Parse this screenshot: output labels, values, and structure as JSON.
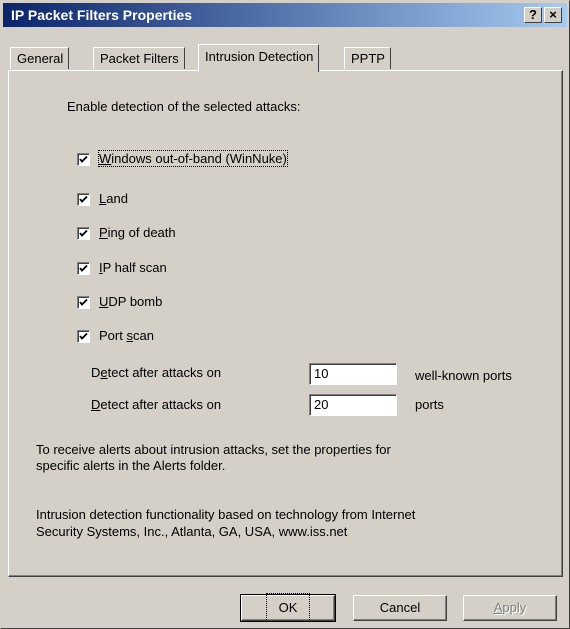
{
  "window": {
    "title": "IP Packet Filters Properties",
    "help_label": "?",
    "close_label": "×"
  },
  "tabs": [
    {
      "label": "General",
      "active": false
    },
    {
      "label": "Packet Filters",
      "active": false
    },
    {
      "label": "Intrusion Detection",
      "active": true
    },
    {
      "label": "PPTP",
      "active": false
    }
  ],
  "intro": "Enable detection of the selected attacks:",
  "attacks": [
    {
      "mnemonic": "W",
      "rest": "indows out-of-band (WinNuke)",
      "checked": true
    },
    {
      "mnemonic": "L",
      "rest": "and",
      "checked": true
    },
    {
      "mnemonic": "P",
      "rest": "ing of death",
      "checked": true
    },
    {
      "mnemonic": "I",
      "rest": "P half scan",
      "checked": true
    },
    {
      "mnemonic": "U",
      "rest": "DP bomb",
      "checked": true
    },
    {
      "pre": "Port ",
      "mnemonic": "s",
      "rest": "can",
      "checked": true
    }
  ],
  "port_scan": {
    "row1": {
      "pre": "D",
      "mnemonic": "e",
      "rest": "tect after attacks on",
      "value": "10",
      "suffix": "well-known ports"
    },
    "row2": {
      "mnemonic": "D",
      "rest": "etect after attacks on",
      "value": "20",
      "suffix": "ports"
    }
  },
  "alerts_note": [
    "To receive alerts about intrusion attacks, set the properties for",
    "specific alerts in the Alerts folder."
  ],
  "credits_note": [
    "Intrusion detection functionality based on technology from Internet",
    "Security Systems, Inc., Atlanta, GA, USA, www.iss.net"
  ],
  "buttons": {
    "ok": "OK",
    "cancel": "Cancel",
    "apply": "Apply"
  }
}
